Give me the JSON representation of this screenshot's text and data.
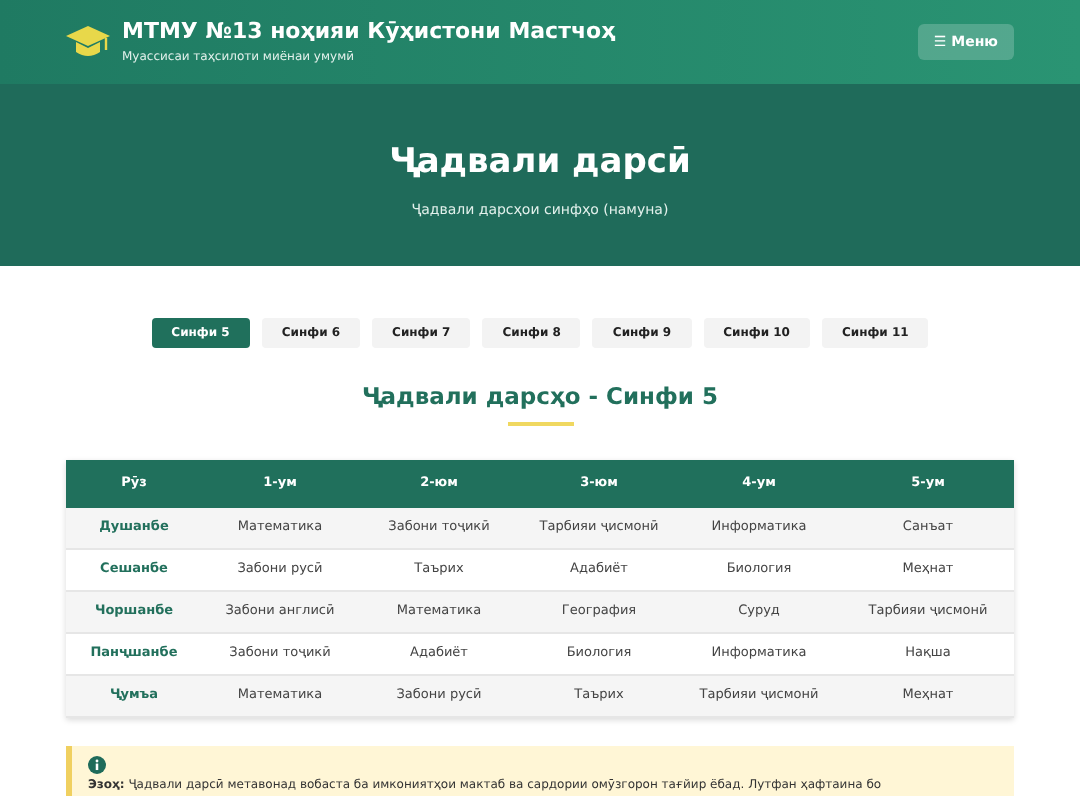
{
  "header": {
    "title": "МТМУ №13 ноҳияи Кӯҳистони Мастчоҳ",
    "subtitle": "Муассисаи таҳсилоти миёнаи умумӣ",
    "menu_button": "☰ Меню"
  },
  "hero": {
    "title": "Ҷадвали дарсӣ",
    "subtitle": "Ҷадвали дарсҳои синфҳо (намуна)"
  },
  "tabs": [
    {
      "label": "Синфи 5",
      "selected": true
    },
    {
      "label": "Синфи 6",
      "selected": false
    },
    {
      "label": "Синфи 7",
      "selected": false
    },
    {
      "label": "Синфи 8",
      "selected": false
    },
    {
      "label": "Синфи 9",
      "selected": false
    },
    {
      "label": "Синфи 10",
      "selected": false
    },
    {
      "label": "Синфи 11",
      "selected": false
    }
  ],
  "schedule_title": "Ҷадвали дарсҳо - Синфи 5",
  "table": {
    "columns": [
      "Рӯз",
      "1-ум",
      "2-юм",
      "3-юм",
      "4-ум",
      "5-ум"
    ],
    "rows": [
      [
        "Душанбе",
        "Математика",
        "Забони тоҷикӣ",
        "Тарбияи ҷисмонӣ",
        "Информатика",
        "Санъат"
      ],
      [
        "Сешанбе",
        "Забони русӣ",
        "Таърих",
        "Адабиёт",
        "Биология",
        "Меҳнат"
      ],
      [
        "Чоршанбе",
        "Забони англисӣ",
        "Математика",
        "География",
        "Суруд",
        "Тарбияи ҷисмонӣ"
      ],
      [
        "Панҷшанбе",
        "Забони тоҷикӣ",
        "Адабиёт",
        "Биология",
        "Информатика",
        "Нақша"
      ],
      [
        "Ҷумъа",
        "Математика",
        "Забони русӣ",
        "Таърих",
        "Тарбияи ҷисмонӣ",
        "Меҳнат"
      ]
    ]
  },
  "notice": {
    "text": "**Эзоҳ:** Ҷадвали дарсӣ метавонад вобаста ба имкониятҳои мактаб ва сардории омӯзгорон тағйир ёбад. Лутфан ҳафтаина бо"
  }
}
